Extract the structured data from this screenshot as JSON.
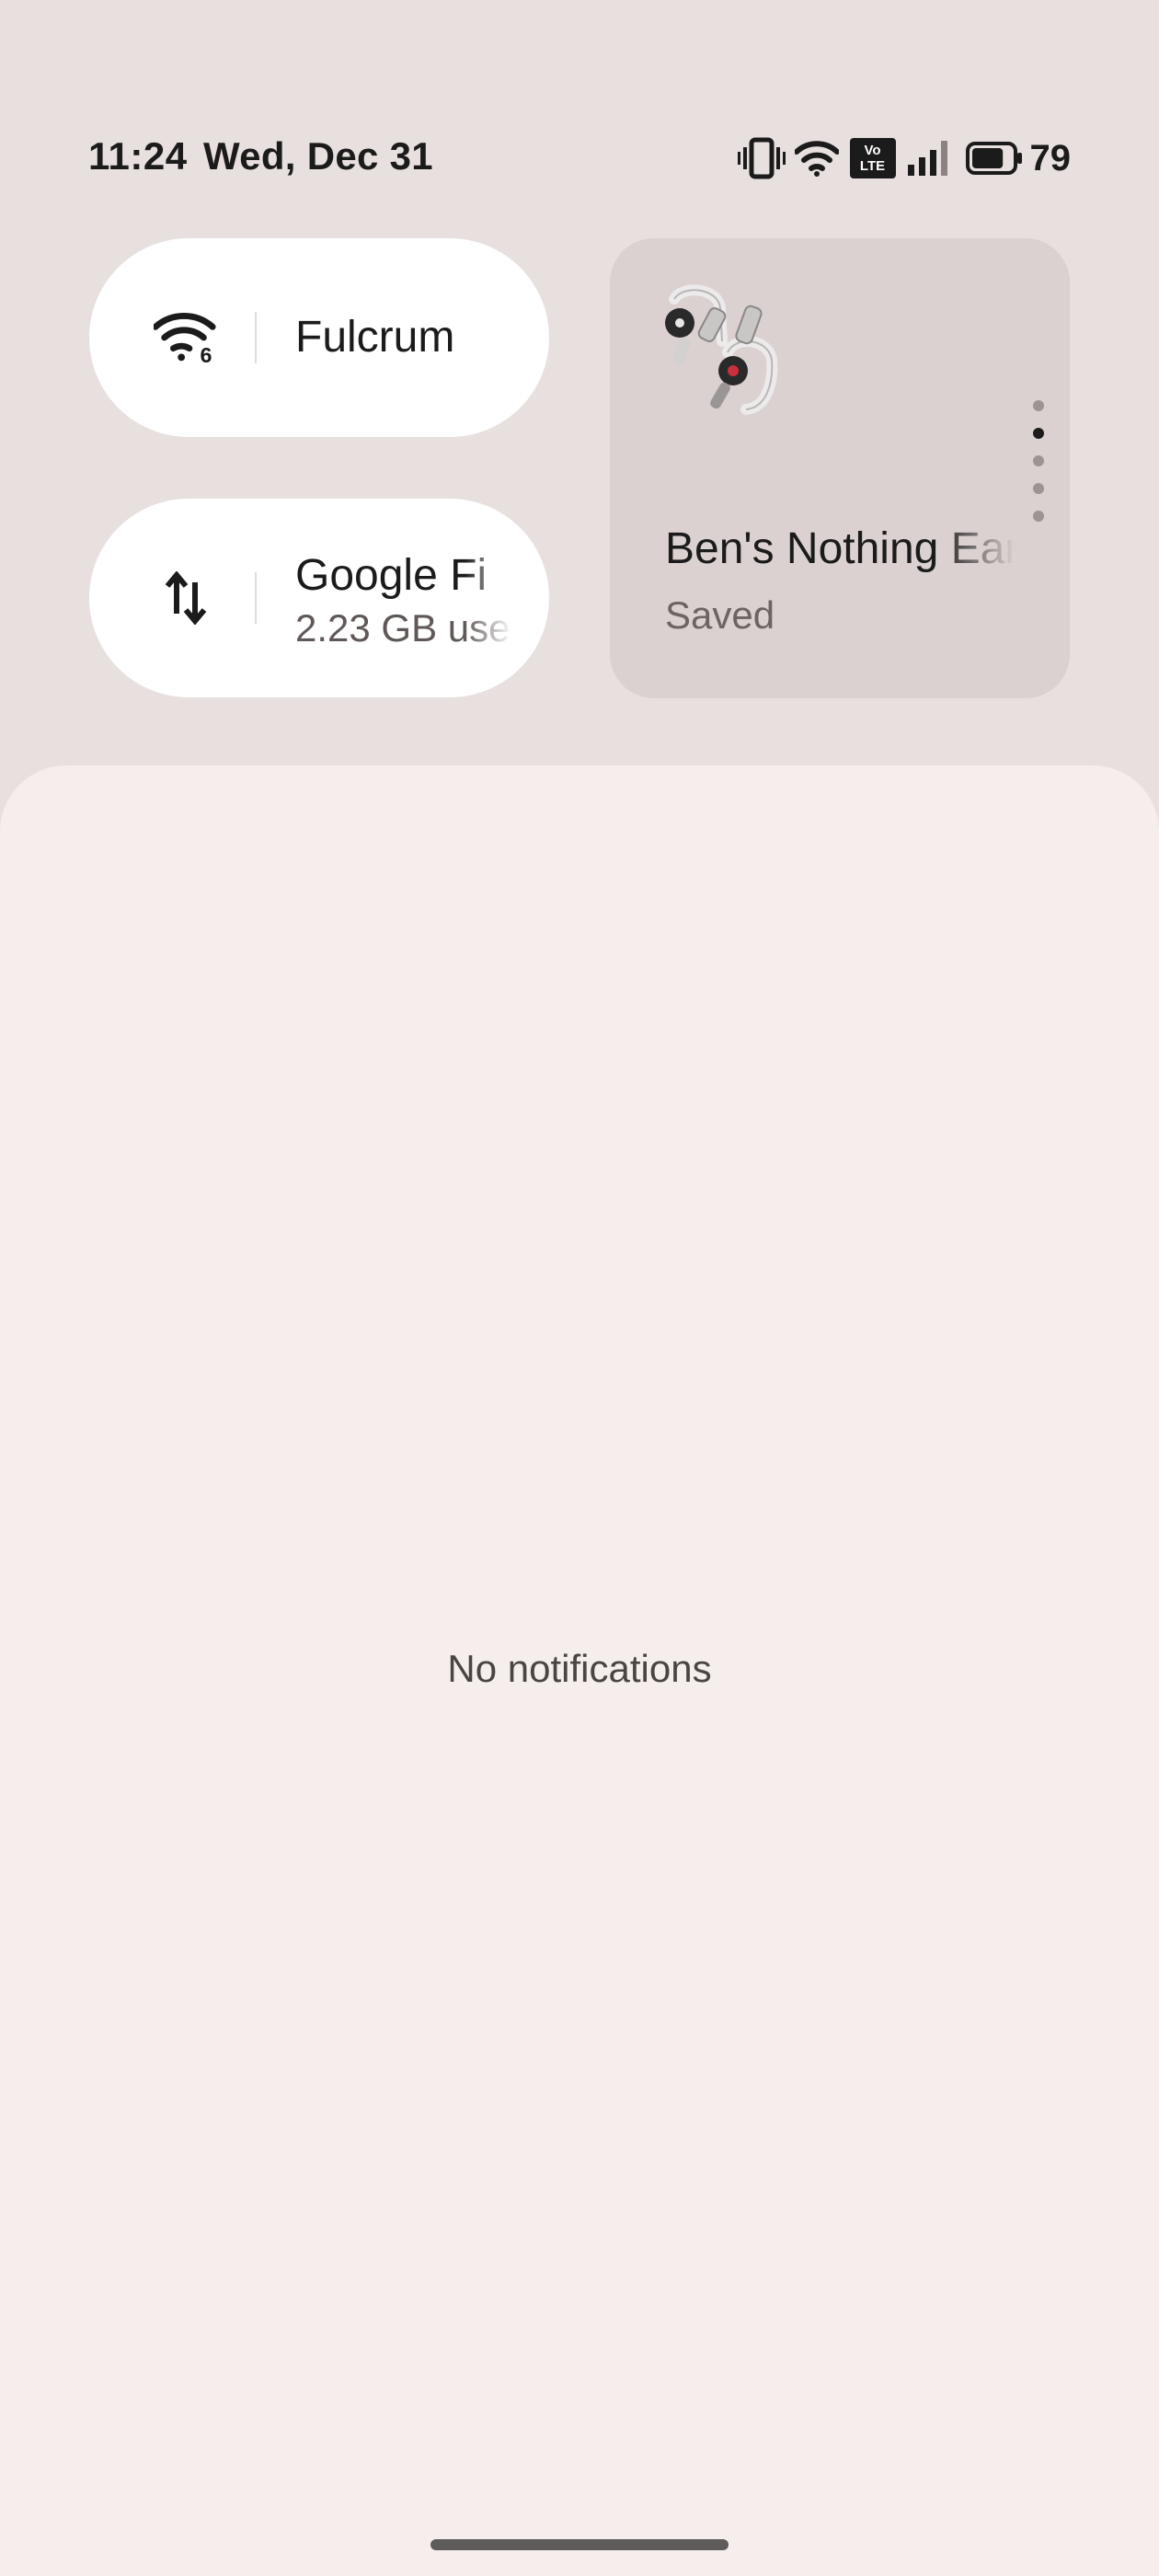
{
  "status_bar": {
    "time": "11:24",
    "date": "Wed, Dec 31",
    "volte_top": "Vo",
    "volte_bottom": "LTE",
    "battery_percent": "79",
    "battery_level": 0.79,
    "icons": [
      "vibrate-icon",
      "wifi-icon",
      "volte-icon",
      "cellular-signal-icon",
      "battery-icon"
    ]
  },
  "tiles": {
    "wifi": {
      "icon": "wifi-6-icon",
      "badge": "6",
      "title": "Fulcrum"
    },
    "mobile_data": {
      "icon": "data-arrows-icon",
      "title": "Google Fi",
      "subtitle": "2.23 GB use"
    }
  },
  "device_card": {
    "image": "earbuds-icon",
    "name": "Ben's Nothing Ear",
    "status": "Saved",
    "page_count": 5,
    "active_page": 1
  },
  "notifications": {
    "empty_text": "No notifications"
  },
  "colors": {
    "background": "#e8e0df",
    "tile": "#ffffff",
    "device_card": "#dad1d0",
    "shade": "#f5eeed",
    "text": "#1c1b1b"
  }
}
